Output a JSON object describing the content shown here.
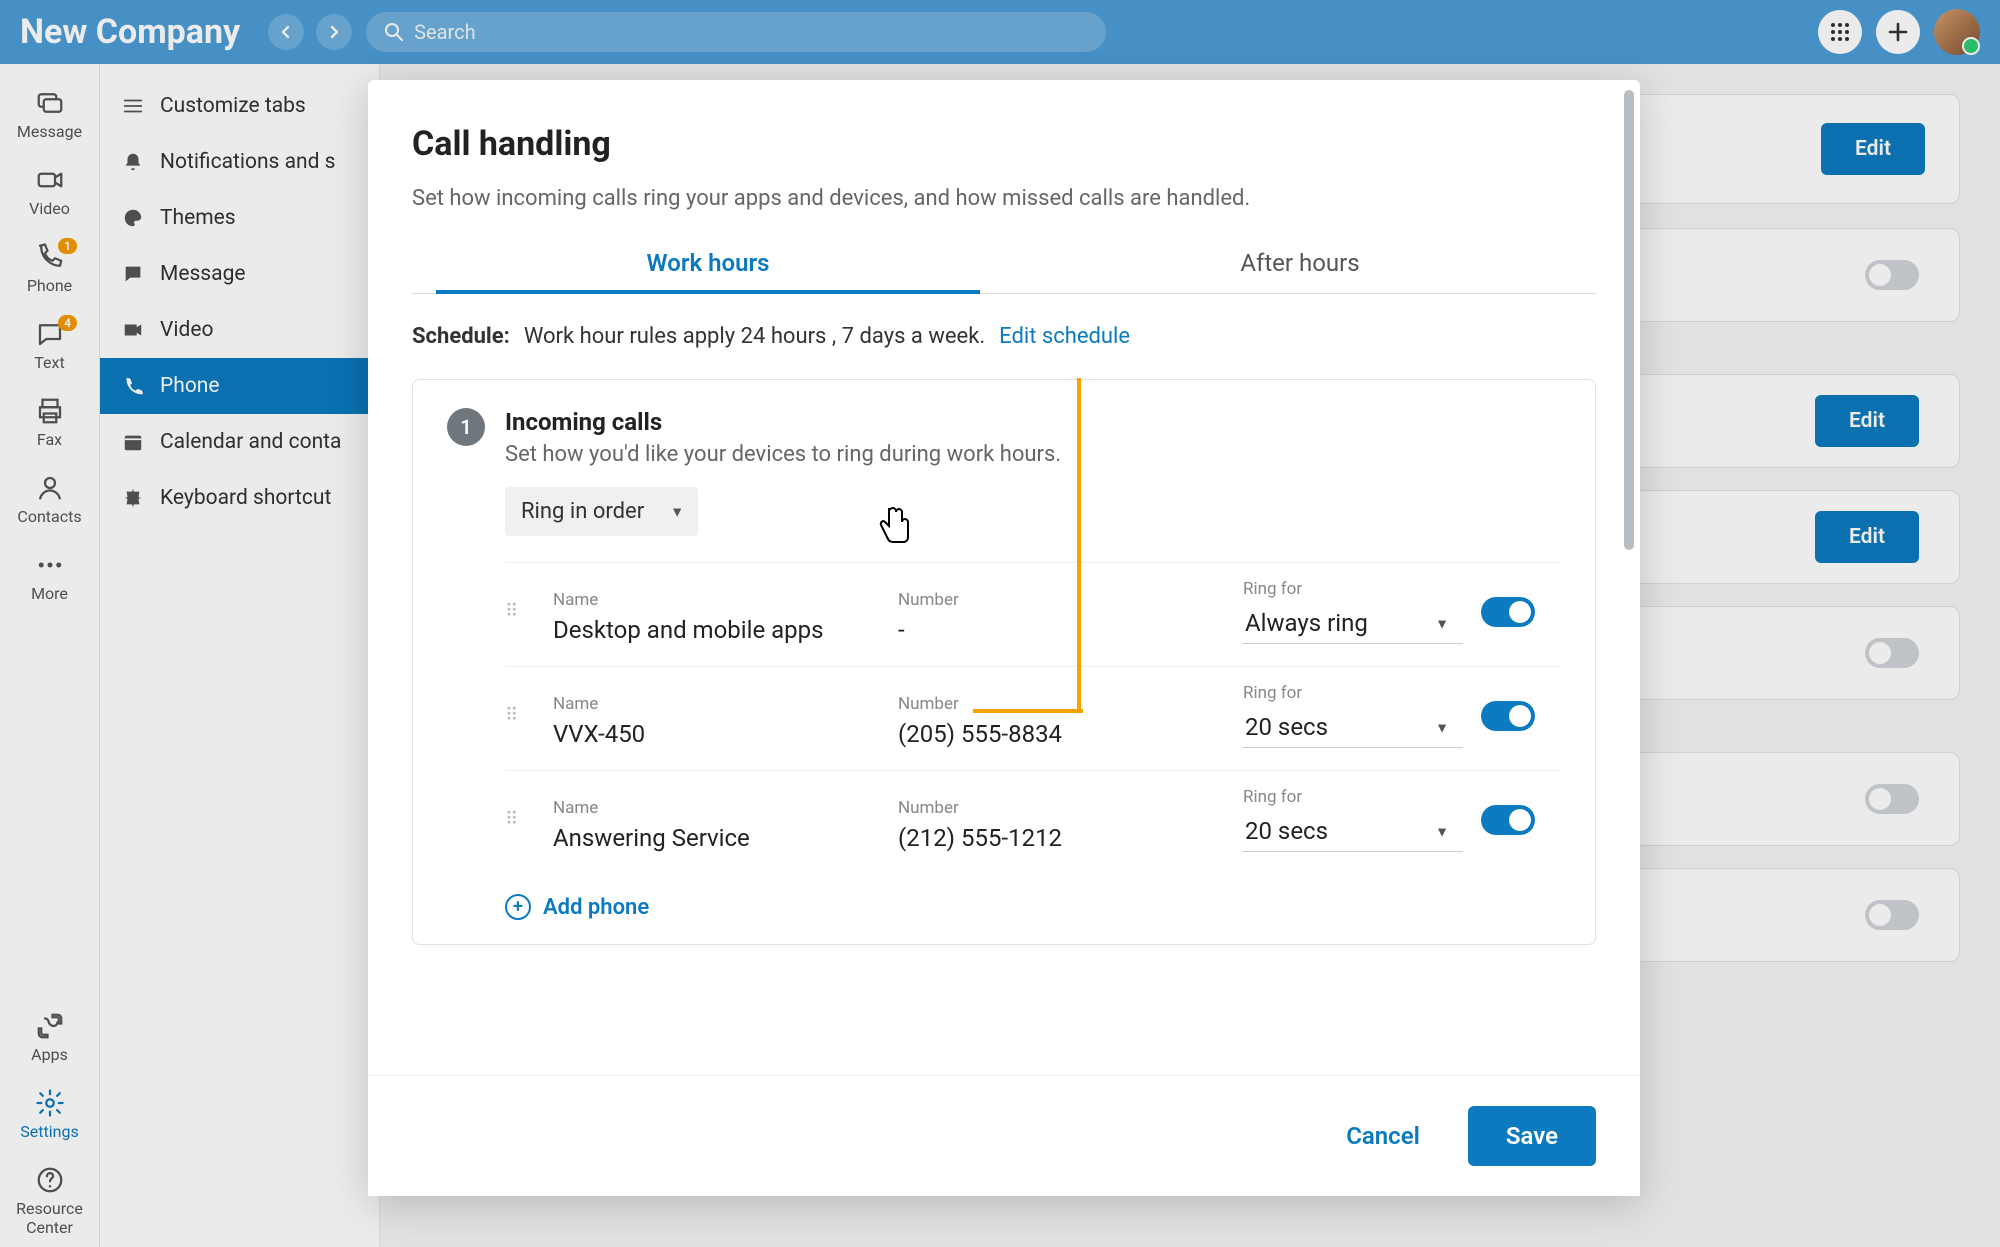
{
  "topbar": {
    "company": "New Company",
    "search_placeholder": "Search"
  },
  "rail": {
    "message": "Message",
    "video": "Video",
    "phone": "Phone",
    "text": "Text",
    "fax": "Fax",
    "contacts": "Contacts",
    "more": "More",
    "apps": "Apps",
    "settings": "Settings",
    "resource1": "Resource",
    "resource2": "Center",
    "badge_phone": "1",
    "badge_text": "4"
  },
  "sidebar": {
    "customize": "Customize tabs",
    "notifications": "Notifications and s",
    "themes": "Themes",
    "message": "Message",
    "video": "Video",
    "phone": "Phone",
    "calendar": "Calendar and conta",
    "keyboard": "Keyboard shortcut"
  },
  "bg": {
    "edit": "Edit"
  },
  "modal": {
    "title": "Call handling",
    "subtitle": "Set how incoming calls ring your apps and devices, and how missed calls are handled.",
    "tab_work": "Work hours",
    "tab_after": "After hours",
    "schedule_label": "Schedule:",
    "schedule_text": "Work hour rules apply 24 hours , 7 days a week.",
    "schedule_link": "Edit schedule",
    "step_num": "1",
    "step_title": "Incoming calls",
    "step_desc": "Set how you'd like your devices to ring during work hours.",
    "ring_mode": "Ring in order",
    "headers": {
      "name": "Name",
      "number": "Number",
      "ringfor": "Ring for"
    },
    "devices": [
      {
        "name": "Desktop and mobile apps",
        "number": "-",
        "ringfor": "Always ring"
      },
      {
        "name": "VVX-450",
        "number": "(205) 555-8834",
        "ringfor": "20 secs"
      },
      {
        "name": "Answering Service",
        "number": "(212) 555-1212",
        "ringfor": "20 secs"
      }
    ],
    "add_phone": "Add phone",
    "cancel": "Cancel",
    "save": "Save"
  }
}
